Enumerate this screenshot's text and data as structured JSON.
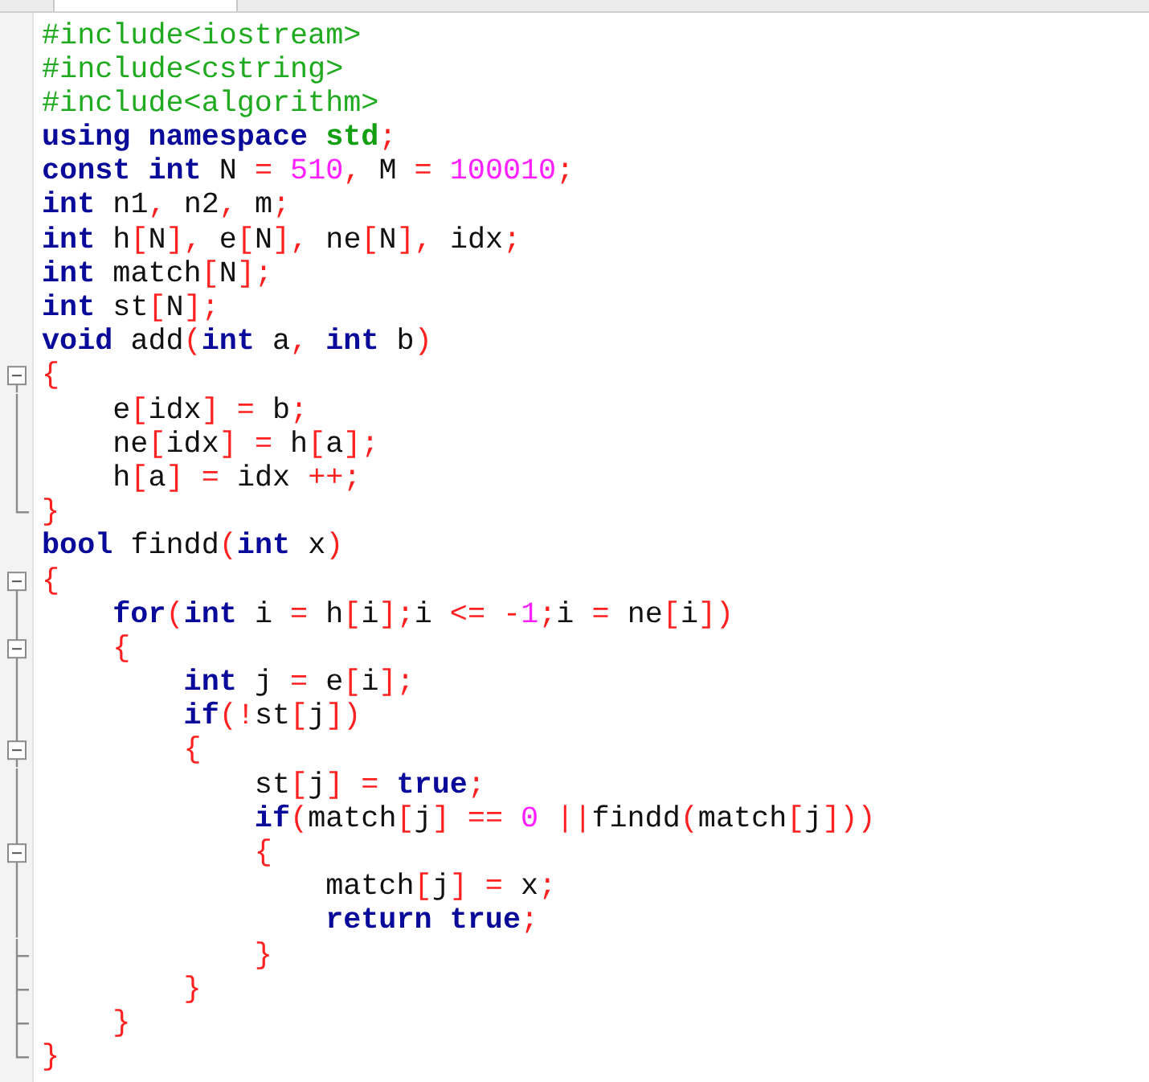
{
  "tab_bar": {
    "tabs": [
      {
        "selected": true
      }
    ]
  },
  "lines": [
    {
      "tokens": [
        {
          "kind": "pre",
          "text": "#include<iostream>"
        }
      ]
    },
    {
      "tokens": [
        {
          "kind": "pre",
          "text": "#include<cstring>"
        }
      ]
    },
    {
      "tokens": [
        {
          "kind": "pre",
          "text": "#include<algorithm>"
        }
      ]
    },
    {
      "tokens": [
        {
          "kind": "kw",
          "text": "using namespace "
        },
        {
          "kind": "ns",
          "text": "std"
        },
        {
          "kind": "op",
          "text": ";"
        }
      ]
    },
    {
      "tokens": [
        {
          "kind": "kw",
          "text": "const int "
        },
        {
          "kind": "id",
          "text": "N "
        },
        {
          "kind": "op",
          "text": "= "
        },
        {
          "kind": "num",
          "text": "510"
        },
        {
          "kind": "op",
          "text": ","
        },
        {
          "kind": "id",
          "text": " M "
        },
        {
          "kind": "op",
          "text": "= "
        },
        {
          "kind": "num",
          "text": "100010"
        },
        {
          "kind": "op",
          "text": ";"
        }
      ]
    },
    {
      "tokens": [
        {
          "kind": "kw",
          "text": "int "
        },
        {
          "kind": "id",
          "text": "n1"
        },
        {
          "kind": "op",
          "text": ","
        },
        {
          "kind": "id",
          "text": " n2"
        },
        {
          "kind": "op",
          "text": ","
        },
        {
          "kind": "id",
          "text": " m"
        },
        {
          "kind": "op",
          "text": ";"
        }
      ]
    },
    {
      "tokens": [
        {
          "kind": "kw",
          "text": "int "
        },
        {
          "kind": "id",
          "text": "h"
        },
        {
          "kind": "op",
          "text": "["
        },
        {
          "kind": "id",
          "text": "N"
        },
        {
          "kind": "op",
          "text": "],"
        },
        {
          "kind": "id",
          "text": " e"
        },
        {
          "kind": "op",
          "text": "["
        },
        {
          "kind": "id",
          "text": "N"
        },
        {
          "kind": "op",
          "text": "],"
        },
        {
          "kind": "id",
          "text": " ne"
        },
        {
          "kind": "op",
          "text": "["
        },
        {
          "kind": "id",
          "text": "N"
        },
        {
          "kind": "op",
          "text": "],"
        },
        {
          "kind": "id",
          "text": " idx"
        },
        {
          "kind": "op",
          "text": ";"
        }
      ]
    },
    {
      "tokens": [
        {
          "kind": "kw",
          "text": "int "
        },
        {
          "kind": "id",
          "text": "match"
        },
        {
          "kind": "op",
          "text": "["
        },
        {
          "kind": "id",
          "text": "N"
        },
        {
          "kind": "op",
          "text": "];"
        }
      ]
    },
    {
      "tokens": [
        {
          "kind": "kw",
          "text": "int "
        },
        {
          "kind": "id",
          "text": "st"
        },
        {
          "kind": "op",
          "text": "["
        },
        {
          "kind": "id",
          "text": "N"
        },
        {
          "kind": "op",
          "text": "];"
        }
      ]
    },
    {
      "tokens": [
        {
          "kind": "kw",
          "text": "void "
        },
        {
          "kind": "id",
          "text": "add"
        },
        {
          "kind": "op",
          "text": "("
        },
        {
          "kind": "kw",
          "text": "int "
        },
        {
          "kind": "id",
          "text": "a"
        },
        {
          "kind": "op",
          "text": ","
        },
        {
          "kind": "kw",
          "text": " int "
        },
        {
          "kind": "id",
          "text": "b"
        },
        {
          "kind": "op",
          "text": ")"
        }
      ]
    },
    {
      "kind": "open",
      "tokens": [
        {
          "kind": "op",
          "text": "{"
        }
      ]
    },
    {
      "kind": "line",
      "tokens": [
        {
          "kind": "id",
          "text": "    e"
        },
        {
          "kind": "op",
          "text": "["
        },
        {
          "kind": "id",
          "text": "idx"
        },
        {
          "kind": "op",
          "text": "] = "
        },
        {
          "kind": "id",
          "text": "b"
        },
        {
          "kind": "op",
          "text": ";"
        }
      ]
    },
    {
      "kind": "line",
      "tokens": [
        {
          "kind": "id",
          "text": "    ne"
        },
        {
          "kind": "op",
          "text": "["
        },
        {
          "kind": "id",
          "text": "idx"
        },
        {
          "kind": "op",
          "text": "] = "
        },
        {
          "kind": "id",
          "text": "h"
        },
        {
          "kind": "op",
          "text": "["
        },
        {
          "kind": "id",
          "text": "a"
        },
        {
          "kind": "op",
          "text": "];"
        }
      ]
    },
    {
      "kind": "line",
      "tokens": [
        {
          "kind": "id",
          "text": "    h"
        },
        {
          "kind": "op",
          "text": "["
        },
        {
          "kind": "id",
          "text": "a"
        },
        {
          "kind": "op",
          "text": "] = "
        },
        {
          "kind": "id",
          "text": "idx "
        },
        {
          "kind": "op",
          "text": "++;"
        }
      ]
    },
    {
      "kind": "end",
      "tokens": [
        {
          "kind": "op",
          "text": "}"
        }
      ]
    },
    {
      "tokens": [
        {
          "kind": "kw",
          "text": "bool "
        },
        {
          "kind": "id",
          "text": "findd"
        },
        {
          "kind": "op",
          "text": "("
        },
        {
          "kind": "kw",
          "text": "int "
        },
        {
          "kind": "id",
          "text": "x"
        },
        {
          "kind": "op",
          "text": ")"
        }
      ]
    },
    {
      "kind": "open",
      "tokens": [
        {
          "kind": "op",
          "text": "{"
        }
      ]
    },
    {
      "kind": "line",
      "tokens": [
        {
          "kind": "kw",
          "text": "    for"
        },
        {
          "kind": "op",
          "text": "("
        },
        {
          "kind": "kw",
          "text": "int "
        },
        {
          "kind": "id",
          "text": "i "
        },
        {
          "kind": "op",
          "text": "= "
        },
        {
          "kind": "id",
          "text": "h"
        },
        {
          "kind": "op",
          "text": "["
        },
        {
          "kind": "id",
          "text": "i"
        },
        {
          "kind": "op",
          "text": "];"
        },
        {
          "kind": "id",
          "text": "i "
        },
        {
          "kind": "op",
          "text": "<= -"
        },
        {
          "kind": "num",
          "text": "1"
        },
        {
          "kind": "op",
          "text": ";"
        },
        {
          "kind": "id",
          "text": "i "
        },
        {
          "kind": "op",
          "text": "= "
        },
        {
          "kind": "id",
          "text": "ne"
        },
        {
          "kind": "op",
          "text": "["
        },
        {
          "kind": "id",
          "text": "i"
        },
        {
          "kind": "op",
          "text": "])"
        }
      ]
    },
    {
      "kind": "open_inner",
      "tokens": [
        {
          "kind": "op",
          "text": "    {"
        }
      ]
    },
    {
      "kind": "line",
      "tokens": [
        {
          "kind": "kw",
          "text": "        int "
        },
        {
          "kind": "id",
          "text": "j "
        },
        {
          "kind": "op",
          "text": "= "
        },
        {
          "kind": "id",
          "text": "e"
        },
        {
          "kind": "op",
          "text": "["
        },
        {
          "kind": "id",
          "text": "i"
        },
        {
          "kind": "op",
          "text": "];"
        }
      ]
    },
    {
      "kind": "line",
      "tokens": [
        {
          "kind": "kw",
          "text": "        if"
        },
        {
          "kind": "op",
          "text": "(!"
        },
        {
          "kind": "id",
          "text": "st"
        },
        {
          "kind": "op",
          "text": "["
        },
        {
          "kind": "id",
          "text": "j"
        },
        {
          "kind": "op",
          "text": "])"
        }
      ]
    },
    {
      "kind": "open_inner",
      "tokens": [
        {
          "kind": "op",
          "text": "        {"
        }
      ]
    },
    {
      "kind": "line",
      "tokens": [
        {
          "kind": "id",
          "text": "            st"
        },
        {
          "kind": "op",
          "text": "["
        },
        {
          "kind": "id",
          "text": "j"
        },
        {
          "kind": "op",
          "text": "] = "
        },
        {
          "kind": "kw",
          "text": "true"
        },
        {
          "kind": "op",
          "text": ";"
        }
      ]
    },
    {
      "kind": "line",
      "tokens": [
        {
          "kind": "kw",
          "text": "            if"
        },
        {
          "kind": "op",
          "text": "("
        },
        {
          "kind": "id",
          "text": "match"
        },
        {
          "kind": "op",
          "text": "["
        },
        {
          "kind": "id",
          "text": "j"
        },
        {
          "kind": "op",
          "text": "] == "
        },
        {
          "kind": "num",
          "text": "0 "
        },
        {
          "kind": "op",
          "text": "||"
        },
        {
          "kind": "id",
          "text": "findd"
        },
        {
          "kind": "op",
          "text": "("
        },
        {
          "kind": "id",
          "text": "match"
        },
        {
          "kind": "op",
          "text": "["
        },
        {
          "kind": "id",
          "text": "j"
        },
        {
          "kind": "op",
          "text": "]))"
        }
      ]
    },
    {
      "kind": "open_inner",
      "tokens": [
        {
          "kind": "op",
          "text": "            {"
        }
      ]
    },
    {
      "kind": "line",
      "tokens": [
        {
          "kind": "id",
          "text": "                match"
        },
        {
          "kind": "op",
          "text": "["
        },
        {
          "kind": "id",
          "text": "j"
        },
        {
          "kind": "op",
          "text": "] = "
        },
        {
          "kind": "id",
          "text": "x"
        },
        {
          "kind": "op",
          "text": ";"
        }
      ]
    },
    {
      "kind": "line",
      "tokens": [
        {
          "kind": "kw",
          "text": "                return true"
        },
        {
          "kind": "op",
          "text": ";"
        }
      ]
    },
    {
      "kind": "tick",
      "tokens": [
        {
          "kind": "op",
          "text": "            }"
        }
      ]
    },
    {
      "kind": "tick",
      "tokens": [
        {
          "kind": "op",
          "text": "        }"
        }
      ]
    },
    {
      "kind": "tick",
      "tokens": [
        {
          "kind": "op",
          "text": "    }"
        }
      ]
    },
    {
      "kind": "end",
      "tokens": [
        {
          "kind": "op",
          "text": "}"
        }
      ]
    }
  ]
}
